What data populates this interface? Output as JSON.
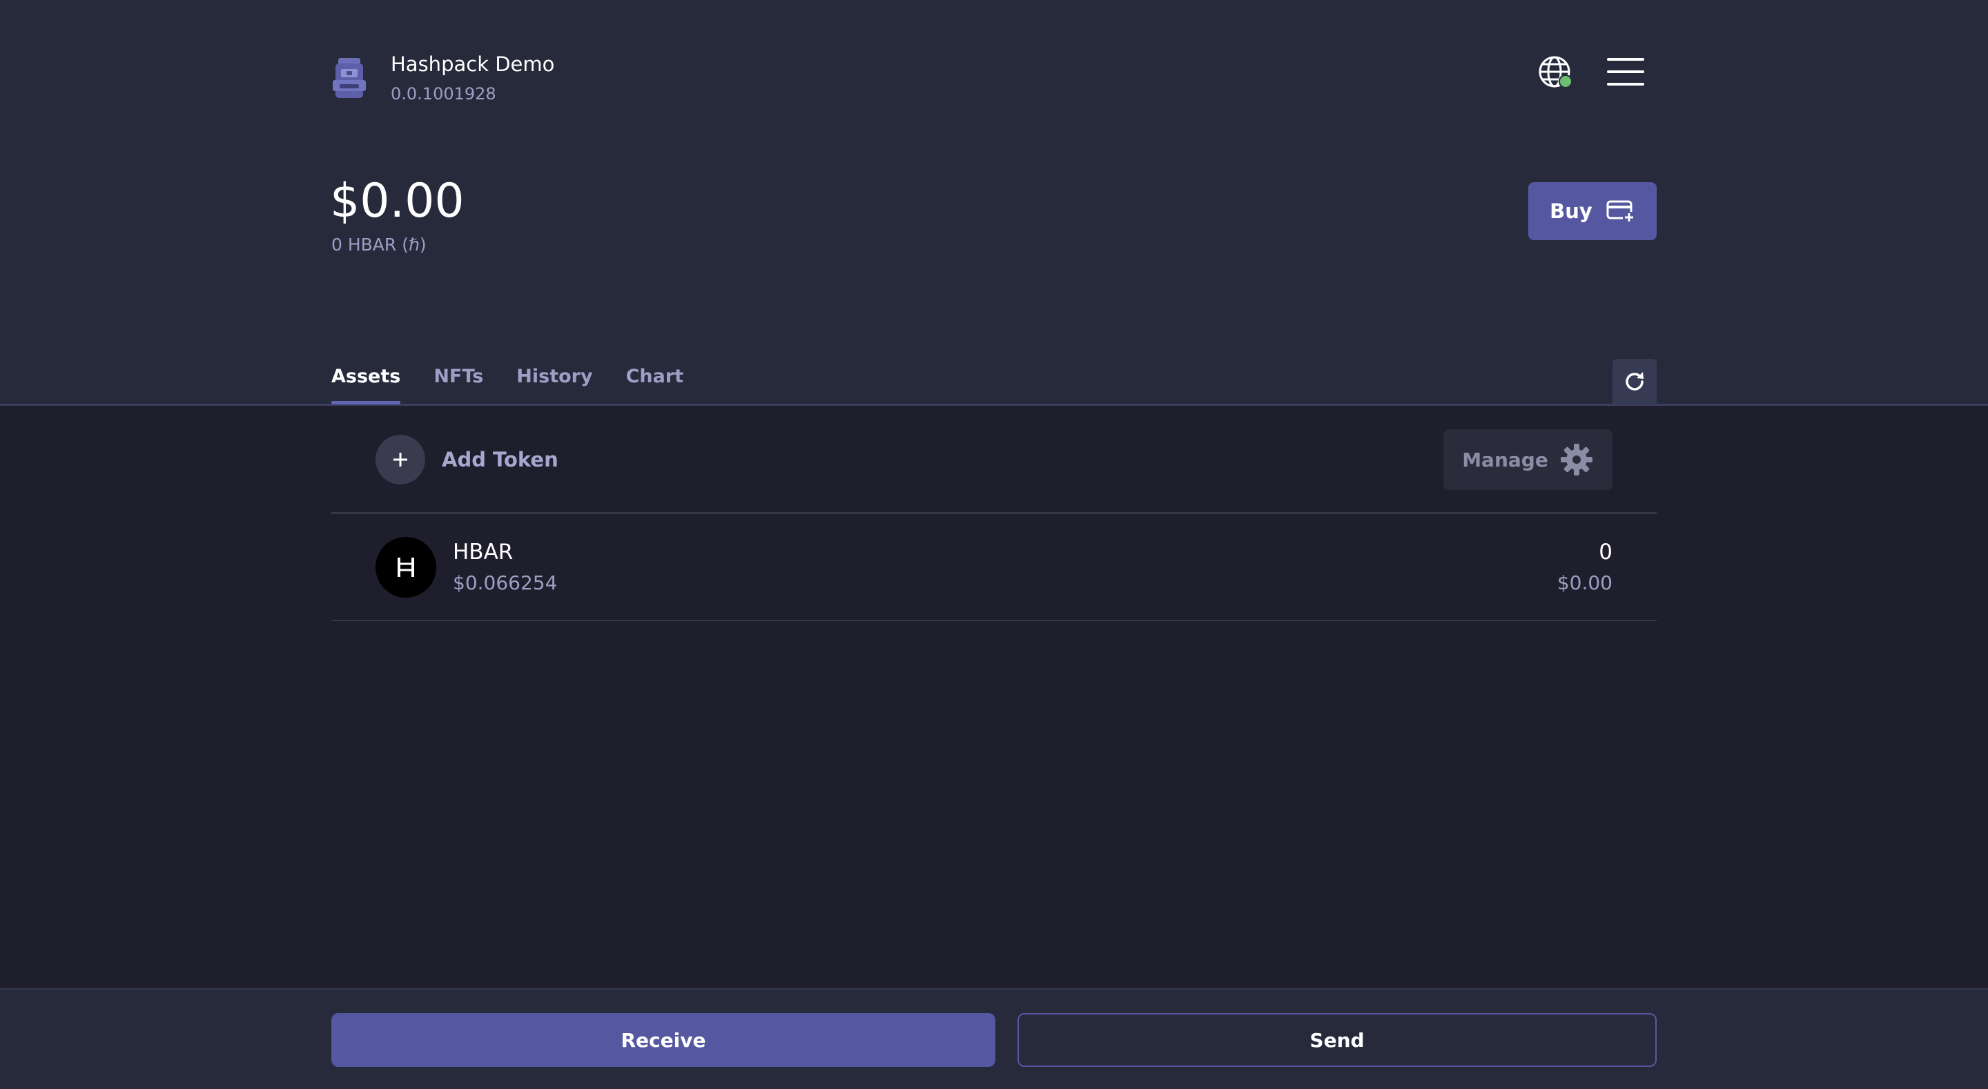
{
  "account": {
    "name": "Hashpack Demo",
    "id": "0.0.1001928",
    "icon": "backpack-icon"
  },
  "header": {
    "network_icon": "globe-icon",
    "network_status_color": "#6cc070",
    "menu_icon": "hamburger-menu-icon"
  },
  "balance": {
    "usd": "$0.00",
    "hbar": "0 HBAR (ℏ)"
  },
  "buy": {
    "label": "Buy",
    "icon": "credit-card-plus-icon"
  },
  "tabs": [
    {
      "label": "Assets",
      "active": true
    },
    {
      "label": "NFTs",
      "active": false
    },
    {
      "label": "History",
      "active": false
    },
    {
      "label": "Chart",
      "active": false
    }
  ],
  "assets": {
    "add_token_label": "Add Token",
    "manage_label": "Manage",
    "tokens": [
      {
        "symbol": "HBAR",
        "logo_glyph": "Ħ",
        "price": "$0.066254",
        "amount": "0",
        "value": "$0.00"
      }
    ]
  },
  "actions": {
    "receive_label": "Receive",
    "send_label": "Send"
  },
  "colors": {
    "accent": "#5558a0",
    "text_muted": "#9d9fc4",
    "header_bg": "#262a3b",
    "body_bg": "#1f1e2c"
  }
}
